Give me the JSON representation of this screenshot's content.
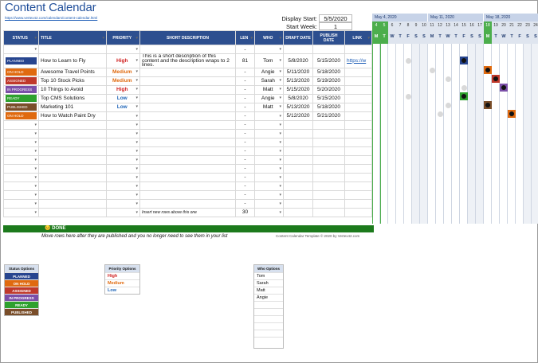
{
  "title": "Content Calendar",
  "url": "https://www.vertex42.com/calendars/content-calendar.html",
  "display_start_label": "Display Start:",
  "display_start_value": "5/5/2020",
  "start_week_label": "Start Week:",
  "start_week_value": "1",
  "columns": {
    "status": "STATUS",
    "title": "TITLE",
    "priority": "PRIORITY",
    "short_description": "SHORT DESCRIPTION",
    "len": "LEN",
    "who": "WHO",
    "draft_date": "DRAFT DATE",
    "publish_date": "PUBLISH DATE",
    "link": "LINK"
  },
  "rows": [
    {
      "status": "PLANNED",
      "status_color": "#27458f",
      "title": "How to Learn to Fly",
      "priority": "High",
      "pclass": "pr-high",
      "desc": "This is a short description of this content and the description wraps to 2 lines.",
      "len": "81",
      "who": "Tom",
      "draft": "5/8/2020",
      "publish": "5/15/2020",
      "link": "https://w"
    },
    {
      "status": "ON HOLD",
      "status_color": "#e06a0f",
      "title": "Awesome Travel Points",
      "priority": "Medium",
      "pclass": "pr-med",
      "desc": "",
      "len": "-",
      "who": "Angie",
      "draft": "5/11/2020",
      "publish": "5/18/2020",
      "link": ""
    },
    {
      "status": "ASSIGNED",
      "status_color": "#c0392b",
      "title": "Top 10 Stock Picks",
      "priority": "Medium",
      "pclass": "pr-med",
      "desc": "",
      "len": "-",
      "who": "Sarah",
      "draft": "5/13/2020",
      "publish": "5/19/2020",
      "link": ""
    },
    {
      "status": "IN PROGRESS",
      "status_color": "#7b4fa8",
      "title": "10 Things to Avoid",
      "priority": "High",
      "pclass": "pr-high",
      "desc": "",
      "len": "-",
      "who": "Matt",
      "draft": "5/15/2020",
      "publish": "5/20/2020",
      "link": ""
    },
    {
      "status": "READY",
      "status_color": "#2ea12e",
      "title": "Top CMS Solutions",
      "priority": "Low",
      "pclass": "pr-low",
      "desc": "",
      "len": "-",
      "who": "Angie",
      "draft": "5/8/2020",
      "publish": "5/15/2020",
      "link": ""
    },
    {
      "status": "PUBLISHED",
      "status_color": "#7a4e2a",
      "title": "Marketing 101",
      "priority": "Low",
      "pclass": "pr-low",
      "desc": "",
      "len": "-",
      "who": "Matt",
      "draft": "5/13/2020",
      "publish": "5/18/2020",
      "link": ""
    },
    {
      "status": "ON HOLD",
      "status_color": "#e06a0f",
      "title": "How to Watch Paint Dry",
      "priority": "",
      "pclass": "",
      "desc": "",
      "len": "-",
      "who": "",
      "draft": "5/12/2020",
      "publish": "5/21/2020",
      "link": ""
    }
  ],
  "insert_note": "Insert new rows above this one",
  "total_len": "30",
  "weeks": [
    "May 4, 2020",
    "May 11, 2020",
    "May 18, 2020"
  ],
  "day_numbers": [
    "4",
    "5",
    "6",
    "7",
    "8",
    "9",
    "10",
    "11",
    "12",
    "13",
    "14",
    "15",
    "16",
    "17",
    "18",
    "19",
    "20",
    "21",
    "22",
    "23",
    "24"
  ],
  "day_letters": [
    "M",
    "T",
    "W",
    "T",
    "F",
    "S",
    "S",
    "M",
    "T",
    "W",
    "T",
    "F",
    "S",
    "S",
    "M",
    "T",
    "W",
    "T",
    "F",
    "S",
    "S"
  ],
  "done_label": "DONE",
  "done_note": "Move rows here after they are published and you no longer need to see them in your list",
  "copyright": "Content Calendar Template © 2020 by Vertex42.com",
  "status_options_title": "Status Options",
  "status_options": [
    {
      "label": "PLANNED",
      "color": "#27458f"
    },
    {
      "label": "ON HOLD",
      "color": "#e06a0f"
    },
    {
      "label": "ASSIGNED",
      "color": "#c0392b"
    },
    {
      "label": "IN PROGRESS",
      "color": "#7b4fa8"
    },
    {
      "label": "READY",
      "color": "#2ea12e"
    },
    {
      "label": "PUBLISHED",
      "color": "#7a4e2a"
    }
  ],
  "priority_options_title": "Priority Options",
  "priority_options": [
    "High",
    "Medium",
    "Low"
  ],
  "who_options_title": "Who Options",
  "who_options": [
    "Tom",
    "Sarah",
    "Matt",
    "Angie"
  ]
}
